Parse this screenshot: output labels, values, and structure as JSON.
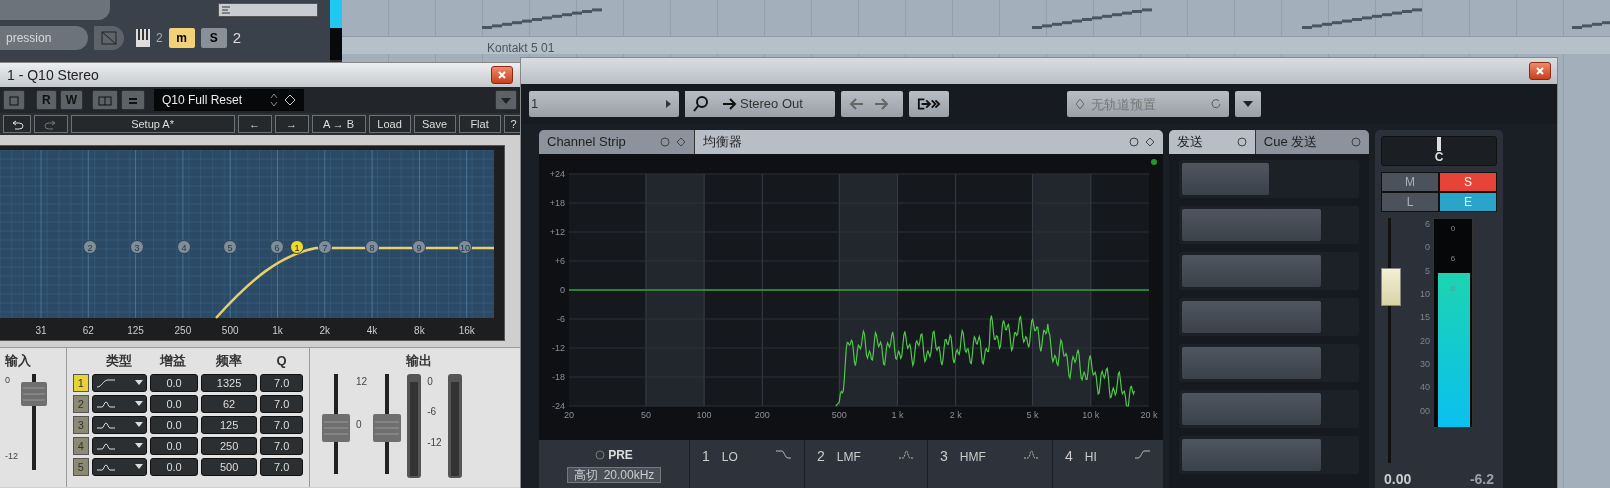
{
  "daw": {
    "track_field": "pression",
    "track_number": "2",
    "mute": {
      "label": "m",
      "on": true
    },
    "solo": {
      "label": "S",
      "on": false
    },
    "channel_number": "2",
    "part_name": "Kontakt 5 01"
  },
  "q10": {
    "title": "1 - Q10 Stereo",
    "toggles": [
      "R",
      "W"
    ],
    "preset": "Q10 Full Reset",
    "actions": [
      "Setup A*",
      "←",
      "→",
      "A → B",
      "Load",
      "Save",
      "Flat",
      "?"
    ],
    "nodes": [
      {
        "label": "2",
        "selected": false
      },
      {
        "label": "3",
        "selected": false
      },
      {
        "label": "4",
        "selected": false
      },
      {
        "label": "5",
        "selected": false
      },
      {
        "label": "6",
        "selected": false
      },
      {
        "label": "1",
        "selected": true
      },
      {
        "label": "7",
        "selected": false
      },
      {
        "label": "8",
        "selected": false
      },
      {
        "label": "9",
        "selected": false
      },
      {
        "label": "10",
        "selected": false
      }
    ],
    "freq_labels": [
      "31",
      "62",
      "125",
      "250",
      "500",
      "1k",
      "2k",
      "4k",
      "8k",
      "16k"
    ],
    "input": {
      "label": "输入",
      "scale": [
        "0",
        "-12"
      ]
    },
    "band_headers": [
      "类型",
      "增益",
      "频率",
      "Q"
    ],
    "bands": [
      {
        "number": "1",
        "selected": true,
        "kind": "shelf",
        "gain": "0.0",
        "freq": "1325",
        "q": "7.0"
      },
      {
        "number": "2",
        "selected": false,
        "kind": "bell",
        "gain": "0.0",
        "freq": "62",
        "q": "7.0"
      },
      {
        "number": "3",
        "selected": false,
        "kind": "bell",
        "gain": "0.0",
        "freq": "125",
        "q": "7.0"
      },
      {
        "number": "4",
        "selected": false,
        "kind": "bell",
        "gain": "0.0",
        "freq": "250",
        "q": "7.0"
      },
      {
        "number": "5",
        "selected": false,
        "kind": "bell",
        "gain": "0.0",
        "freq": "500",
        "q": "7.0"
      }
    ],
    "output": {
      "label": "输出",
      "fader_scale": [
        "12",
        "0"
      ],
      "meter_scale": [
        "0",
        "-6",
        "-12"
      ]
    }
  },
  "channel": {
    "input_field": "1",
    "output": "Stereo Out",
    "preset_placeholder": "无轨道预置",
    "strip_tab": "Channel Strip",
    "eq_title": "均衡器",
    "eq_graph": {
      "yticks": [
        "+24",
        "+18",
        "+12",
        "+6",
        "0",
        "-6",
        "-12",
        "-18",
        "-24"
      ],
      "xticks": [
        "20",
        "50",
        "100",
        "200",
        "500",
        "1 k",
        "2 k",
        "5 k",
        "10 k",
        "20 k"
      ]
    },
    "pre": {
      "label": "PRE",
      "on": false
    },
    "high_cut": {
      "label": "高切",
      "value": "20.00kHz"
    },
    "eq_bands": [
      {
        "number": "1",
        "name": "LO",
        "kind": "low-shelf"
      },
      {
        "number": "2",
        "name": "LMF",
        "kind": "peak"
      },
      {
        "number": "3",
        "name": "HMF",
        "kind": "peak"
      },
      {
        "number": "4",
        "name": "HI",
        "kind": "high-shelf"
      }
    ],
    "sends_tab": "发送",
    "cue_tab": "Cue 发送",
    "sends": [
      {
        "level": 0.5
      },
      {
        "level": 0.8
      },
      {
        "level": 0.8
      },
      {
        "level": 0.8
      },
      {
        "level": 0.8
      },
      {
        "level": 0.8
      },
      {
        "level": 0.8
      }
    ],
    "pan": "C",
    "buttons": [
      {
        "label": "M",
        "kind": "mute",
        "on": false
      },
      {
        "label": "S",
        "kind": "solo",
        "on": true
      },
      {
        "label": "L",
        "kind": "listen",
        "on": false
      },
      {
        "label": "E",
        "kind": "edit",
        "on": true
      }
    ],
    "fader_scale": [
      "6",
      "0",
      "5",
      "10",
      "15",
      "20",
      "30",
      "40",
      "00"
    ],
    "fader": {
      "level": 0.72
    },
    "meter_scale": [
      "0",
      "6",
      "0"
    ],
    "meter": {
      "level": 0.74
    },
    "volume": "0.00",
    "peak": "-6.2"
  }
}
